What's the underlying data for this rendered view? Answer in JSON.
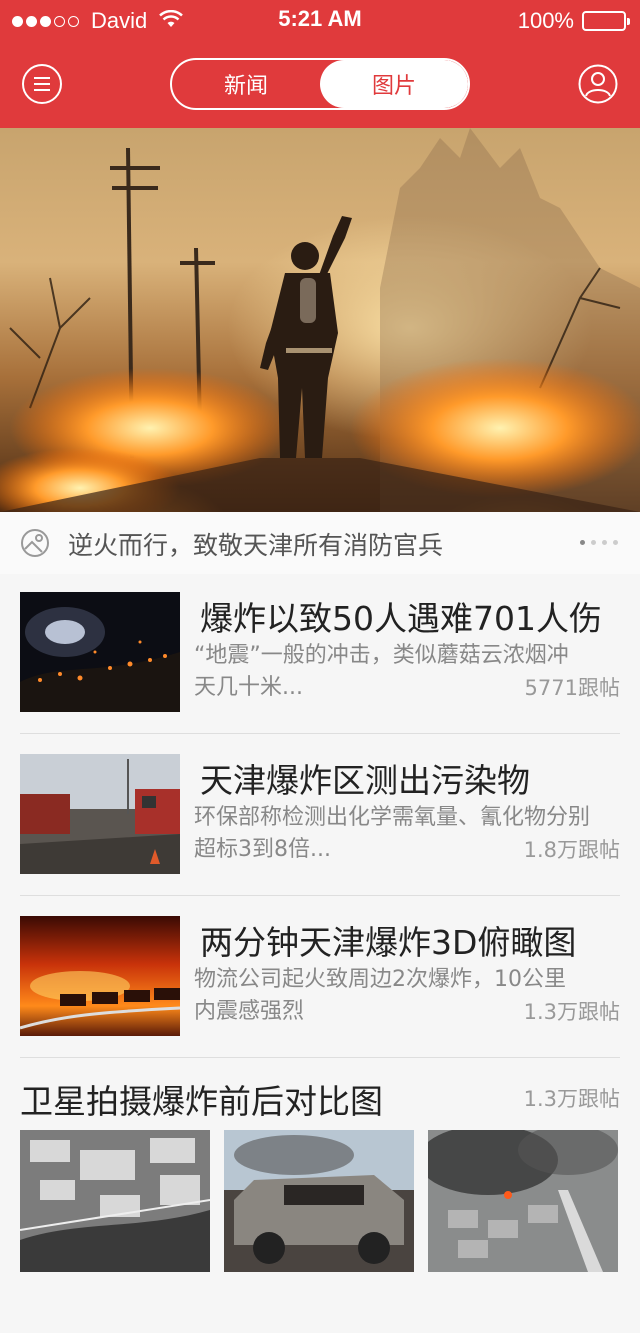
{
  "status_bar": {
    "carrier": "David",
    "time": "5:21 AM",
    "battery": "100%"
  },
  "nav": {
    "tabs": [
      {
        "label": "新闻",
        "active": false
      },
      {
        "label": "图片",
        "active": true
      }
    ]
  },
  "hero": {
    "caption": "逆火而行，致敬天津所有消防官兵",
    "page_count": 4,
    "current_page": 1
  },
  "news": [
    {
      "title": "爆炸以致50人遇难701人伤",
      "desc_line1": "“地震”一般的冲击，类似蘑菇云浓烟冲",
      "desc_line2": "天几十米...",
      "count": "5771跟帖"
    },
    {
      "title": "天津爆炸区测出污染物",
      "desc_line1": "环保部称检测出化学需氧量、氰化物分别",
      "desc_line2": "超标3到8倍...",
      "count": "1.8万跟帖"
    },
    {
      "title": "两分钟天津爆炸3D俯瞰图",
      "desc_line1": "物流公司起火致周边2次爆炸，10公里",
      "desc_line2": "内震感强烈",
      "count": "1.3万跟帖"
    }
  ],
  "gallery": {
    "title": "卫星拍摄爆炸前后对比图",
    "count": "1.3万跟帖"
  },
  "colors": {
    "brand_red": "#e03a3c"
  }
}
